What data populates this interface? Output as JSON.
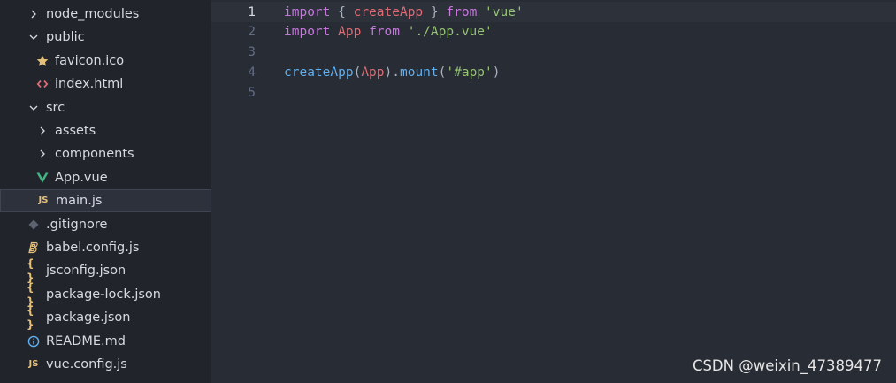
{
  "sidebar": {
    "items": [
      {
        "label": "node_modules",
        "kind": "folder",
        "expanded": false,
        "depth": 0
      },
      {
        "label": "public",
        "kind": "folder",
        "expanded": true,
        "depth": 0
      },
      {
        "label": "favicon.ico",
        "kind": "file",
        "icon": "star-icon",
        "depth": 1
      },
      {
        "label": "index.html",
        "kind": "file",
        "icon": "html-icon",
        "depth": 1
      },
      {
        "label": "src",
        "kind": "folder",
        "expanded": true,
        "depth": 0
      },
      {
        "label": "assets",
        "kind": "folder",
        "expanded": false,
        "depth": 1
      },
      {
        "label": "components",
        "kind": "folder",
        "expanded": false,
        "depth": 1
      },
      {
        "label": "App.vue",
        "kind": "file",
        "icon": "vue-icon",
        "depth": 1
      },
      {
        "label": "main.js",
        "kind": "file",
        "icon": "js-icon",
        "depth": 1,
        "selected": true
      },
      {
        "label": ".gitignore",
        "kind": "file",
        "icon": "git-icon",
        "depth": 0
      },
      {
        "label": "babel.config.js",
        "kind": "file",
        "icon": "babel-icon",
        "depth": 0
      },
      {
        "label": "jsconfig.json",
        "kind": "file",
        "icon": "json-icon",
        "depth": 0
      },
      {
        "label": "package-lock.json",
        "kind": "file",
        "icon": "json-icon",
        "depth": 0
      },
      {
        "label": "package.json",
        "kind": "file",
        "icon": "json-icon",
        "depth": 0
      },
      {
        "label": "README.md",
        "kind": "file",
        "icon": "info-icon",
        "depth": 0
      },
      {
        "label": "vue.config.js",
        "kind": "file",
        "icon": "js-icon",
        "depth": 0
      }
    ],
    "js_glyph": "JS",
    "json_glyph": "{ }"
  },
  "editor": {
    "current_line": 1,
    "lines": [
      {
        "number": "1",
        "tokens": [
          {
            "t": "import",
            "c": "kw"
          },
          {
            "t": " { ",
            "c": "punc"
          },
          {
            "t": "createApp",
            "c": "var"
          },
          {
            "t": " } ",
            "c": "punc"
          },
          {
            "t": "from",
            "c": "kw"
          },
          {
            "t": " ",
            "c": "punc"
          },
          {
            "t": "'vue'",
            "c": "str"
          }
        ]
      },
      {
        "number": "2",
        "tokens": [
          {
            "t": "import",
            "c": "kw"
          },
          {
            "t": " ",
            "c": "punc"
          },
          {
            "t": "App",
            "c": "var"
          },
          {
            "t": " ",
            "c": "punc"
          },
          {
            "t": "from",
            "c": "kw"
          },
          {
            "t": " ",
            "c": "punc"
          },
          {
            "t": "'./App.vue'",
            "c": "str"
          }
        ]
      },
      {
        "number": "3",
        "tokens": []
      },
      {
        "number": "4",
        "tokens": [
          {
            "t": "createApp",
            "c": "fn"
          },
          {
            "t": "(",
            "c": "punc"
          },
          {
            "t": "App",
            "c": "var"
          },
          {
            "t": ").",
            "c": "punc"
          },
          {
            "t": "mount",
            "c": "fn"
          },
          {
            "t": "(",
            "c": "punc"
          },
          {
            "t": "'#app'",
            "c": "str"
          },
          {
            "t": ")",
            "c": "punc"
          }
        ]
      },
      {
        "number": "5",
        "tokens": []
      }
    ]
  },
  "watermark": "CSDN @weixin_47389477",
  "colors": {
    "star": "#e5c07b",
    "html": "#e06c75",
    "vue": "#41b883",
    "git": "#5c6370",
    "babel": "#e5c07b",
    "info": "#61afef",
    "chevron": "#d7dae0"
  }
}
